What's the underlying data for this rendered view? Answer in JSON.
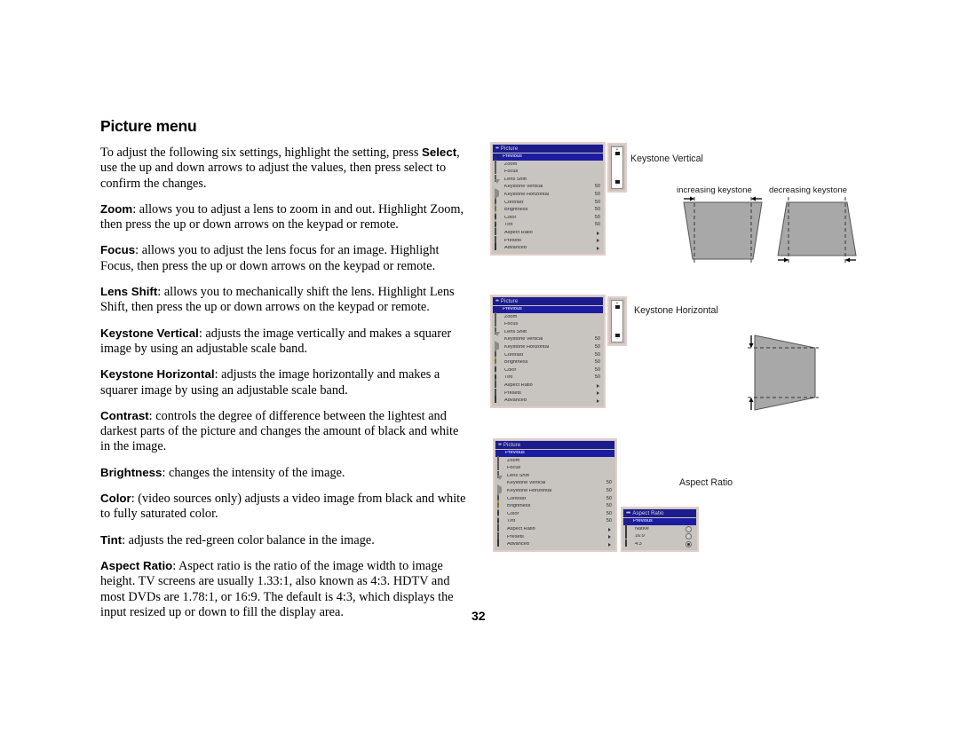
{
  "document": {
    "page_title": "Picture menu",
    "page_number": "32",
    "paragraphs": [
      {
        "id": "intro",
        "lead": "",
        "text_parts": [
          {
            "t": "To adjust the following six settings, highlight the setting, press ",
            "b": false
          },
          {
            "t": "Select",
            "b": true
          },
          {
            "t": ", use the up and down arrows to adjust the values, then press select to confirm the changes.",
            "b": false
          }
        ]
      },
      {
        "id": "zoom",
        "text_parts": [
          {
            "t": "Zoom",
            "b": true
          },
          {
            "t": ": allows you to adjust a lens to zoom in and out. Highlight Zoom, then press the up or down arrows on the keypad or remote.",
            "b": false
          }
        ]
      },
      {
        "id": "focus",
        "text_parts": [
          {
            "t": "Focus",
            "b": true
          },
          {
            "t": ": allows you to adjust the lens focus for an image. Highlight Focus, then press the up or down arrows on the keypad or remote.",
            "b": false
          }
        ]
      },
      {
        "id": "lens-shift",
        "text_parts": [
          {
            "t": "Lens Shift",
            "b": true
          },
          {
            "t": ": allows you to mechanically shift the lens. Highlight Lens Shift, then press the up or down arrows on the keypad or remote.",
            "b": false
          }
        ]
      },
      {
        "id": "keystone-vertical",
        "text_parts": [
          {
            "t": "Keystone Vertical",
            "b": true
          },
          {
            "t": ": adjusts the image vertically and makes a squarer image by using an adjustable scale band.",
            "b": false
          }
        ]
      },
      {
        "id": "keystone-horizontal",
        "text_parts": [
          {
            "t": "Keystone Horizontal",
            "b": true
          },
          {
            "t": ": adjusts the image horizontally and makes a squarer image by using an adjustable scale band.",
            "b": false
          }
        ]
      },
      {
        "id": "contrast",
        "text_parts": [
          {
            "t": "Contrast",
            "b": true
          },
          {
            "t": ": controls the degree of difference between the lightest and darkest parts of the picture and changes the amount of black and white in the image.",
            "b": false
          }
        ]
      },
      {
        "id": "brightness",
        "text_parts": [
          {
            "t": "Brightness",
            "b": true
          },
          {
            "t": ": changes the intensity of the image.",
            "b": false
          }
        ]
      },
      {
        "id": "color",
        "text_parts": [
          {
            "t": "Color",
            "b": true
          },
          {
            "t": ": (video sources only) adjusts a video image from black and white to fully saturated color.",
            "b": false
          }
        ]
      },
      {
        "id": "tint",
        "text_parts": [
          {
            "t": "Tint",
            "b": true
          },
          {
            "t": ": adjusts the red-green color balance in the image.",
            "b": false
          }
        ]
      },
      {
        "id": "aspect-ratio",
        "text_parts": [
          {
            "t": "Aspect Ratio",
            "b": true
          },
          {
            "t": ": Aspect ratio is the ratio of the image width to image height. TV screens are usually 1.33:1, also known as 4:3. HDTV and most DVDs are 1.78:1, or 16:9. The default is 4:3, which displays the input resized up or down to fill the display area.",
            "b": false
          }
        ]
      }
    ]
  },
  "osd": {
    "picture_menu": {
      "title": "Picture",
      "title_dots": "••",
      "rows": [
        {
          "label": "Previous",
          "icon": "previous-icon",
          "value": "",
          "kind": "selected"
        },
        {
          "label": "Zoom",
          "icon": "zoom-icon",
          "value": "",
          "kind": "plain"
        },
        {
          "label": "Focus",
          "icon": "focus-icon",
          "value": "",
          "kind": "plain"
        },
        {
          "label": "Lens Shift",
          "icon": "lens-shift-icon",
          "value": "",
          "kind": "plain"
        },
        {
          "label": "Keystone Vertical",
          "icon": "keystone-vertical-icon",
          "value": "50",
          "kind": "value"
        },
        {
          "label": "Keystone Horizontal",
          "icon": "keystone-horizontal-icon",
          "value": "50",
          "kind": "value"
        },
        {
          "label": "Contrast",
          "icon": "contrast-icon",
          "value": "50",
          "kind": "value"
        },
        {
          "label": "Brightness",
          "icon": "brightness-icon",
          "value": "50",
          "kind": "value"
        },
        {
          "label": "Color",
          "icon": "color-icon",
          "value": "50",
          "kind": "value"
        },
        {
          "label": "Tint",
          "icon": "tint-icon",
          "value": "50",
          "kind": "value"
        },
        {
          "label": "Aspect Ratio",
          "icon": "aspect-ratio-icon",
          "value": "",
          "kind": "submenu"
        },
        {
          "label": "Presets",
          "icon": "presets-icon",
          "value": "",
          "kind": "submenu"
        },
        {
          "label": "Advanced",
          "icon": "advanced-icon",
          "value": "",
          "kind": "submenu"
        }
      ]
    },
    "aspect_ratio_menu": {
      "title": "Aspect Ratio",
      "title_dots": "•••",
      "rows": [
        {
          "label": "Previous",
          "icon": "previous-icon",
          "kind": "selected",
          "checked": false
        },
        {
          "label": "Native",
          "icon": "native-icon",
          "kind": "radio",
          "checked": false
        },
        {
          "label": "16:9",
          "icon": "ratio-16-9-icon",
          "kind": "radio",
          "checked": false
        },
        {
          "label": "4:3",
          "icon": "ratio-4-3-icon",
          "kind": "radio",
          "checked": true
        }
      ]
    },
    "slider": {
      "plus": "+",
      "minus": "-"
    }
  },
  "diagrams": {
    "keystone_vertical": {
      "caption": "Keystone Vertical",
      "left_label": "increasing keystone",
      "right_label": "decreasing keystone"
    },
    "keystone_horizontal": {
      "caption": "Keystone Horizontal"
    },
    "aspect_ratio": {
      "caption": "Aspect Ratio"
    }
  },
  "colors": {
    "menu_titlebar": "#1c1c8c",
    "menu_selected": "#1c1ca0",
    "menu_background": "#c8c4c0",
    "menu_border": "#e2cdc8",
    "shape_fill": "#a8a8a8",
    "shape_stroke": "#555555"
  }
}
